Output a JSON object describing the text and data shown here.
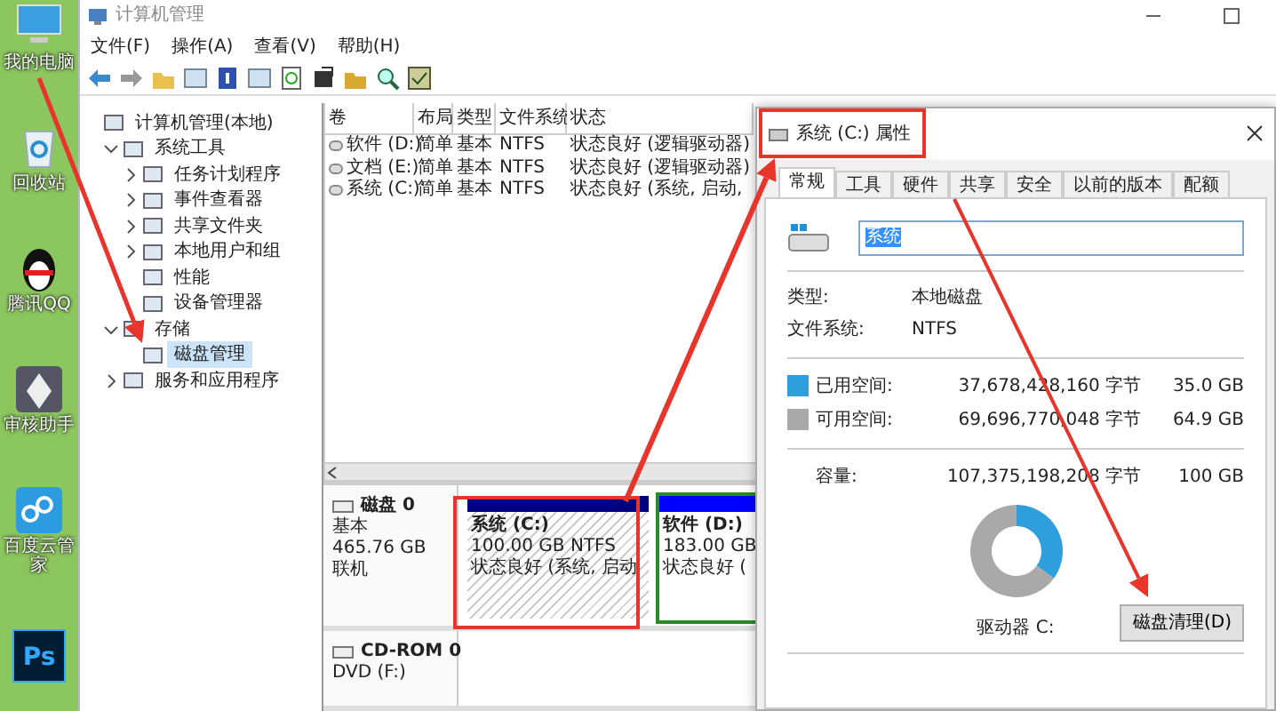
{
  "desktop": {
    "icons": [
      {
        "kind": "computer",
        "label": "我的电脑"
      },
      {
        "kind": "recycle",
        "label": "回收站"
      },
      {
        "kind": "penguin",
        "label": "腾讯QQ"
      },
      {
        "kind": "pen",
        "label": "审核助手"
      },
      {
        "kind": "cloud",
        "label": "百度云管家"
      },
      {
        "kind": "ps",
        "logo_text": "Ps"
      }
    ]
  },
  "window": {
    "title": "计算机管理",
    "menu": [
      "文件(F)",
      "操作(A)",
      "查看(V)",
      "帮助(H)"
    ]
  },
  "tree": [
    {
      "label": "计算机管理(本地)",
      "selected": false,
      "children": [
        {
          "label": "系统工具",
          "expanded": true,
          "selected": false,
          "children": [
            {
              "label": "任务计划程序",
              "expanded": false,
              "selected": false
            },
            {
              "label": "事件查看器",
              "expanded": false,
              "selected": false
            },
            {
              "label": "共享文件夹",
              "expanded": false,
              "selected": false
            },
            {
              "label": "本地用户和组",
              "expanded": false,
              "selected": false
            },
            {
              "label": "性能",
              "selected": false
            },
            {
              "label": "设备管理器",
              "selected": false
            }
          ]
        },
        {
          "label": "存储",
          "expanded": true,
          "selected": false,
          "children": [
            {
              "label": "磁盘管理",
              "selected": true
            }
          ]
        },
        {
          "label": "服务和应用程序",
          "expanded": false,
          "selected": false
        }
      ]
    }
  ],
  "volume_table": {
    "columns": [
      "卷",
      "布局",
      "类型",
      "文件系统",
      "状态"
    ],
    "rows": [
      [
        "软件 (D:)",
        "简单",
        "基本",
        "NTFS",
        "状态良好 (逻辑驱动器)"
      ],
      [
        "文档 (E:)",
        "简单",
        "基本",
        "NTFS",
        "状态良好 (逻辑驱动器)"
      ],
      [
        "系统 (C:)",
        "简单",
        "基本",
        "NTFS",
        "状态良好 (系统, 启动,"
      ]
    ]
  },
  "disk_map": [
    {
      "name": "磁盘 0",
      "details": [
        "基本",
        "465.76 GB",
        "联机"
      ],
      "partitions": [
        {
          "kind": "primary",
          "selected": true,
          "name": "系统 (C:)",
          "size": "100.00 GB NTFS",
          "status": "状态良好 (系统, 启动"
        },
        {
          "kind": "logical",
          "selected": false,
          "name": "软件 (D:)",
          "size": "183.00 GB",
          "status": "状态良好 ("
        }
      ]
    },
    {
      "name": "CD-ROM 0",
      "details": [
        "DVD (F:)"
      ]
    }
  ],
  "dialog": {
    "title": "系统 (C:) 属性",
    "tabs": [
      {
        "label": "常规",
        "selected": true
      },
      {
        "label": "工具",
        "selected": false
      },
      {
        "label": "硬件",
        "selected": false
      },
      {
        "label": "共享",
        "selected": false
      },
      {
        "label": "安全",
        "selected": false
      },
      {
        "label": "以前的版本",
        "selected": false
      },
      {
        "label": "配额",
        "selected": false
      }
    ],
    "name_value": "系统",
    "properties": [
      {
        "label": "类型:",
        "value": "本地磁盘"
      },
      {
        "label": "文件系统:",
        "value": "NTFS"
      }
    ],
    "space": [
      {
        "label": "已用空间:",
        "bytes": "37,678,428,160 字节",
        "size": "35.0 GB",
        "color": "#2e9fdc"
      },
      {
        "label": "可用空间:",
        "bytes": "69,696,770,048 字节",
        "size": "64.9 GB",
        "color": "#a9a9a9"
      }
    ],
    "capacity": {
      "label": "容量:",
      "bytes": "107,375,198,208 字节",
      "size": "100 GB"
    },
    "chart_data": {
      "type": "donut",
      "values": [
        35.0,
        64.9
      ]
    },
    "drive_label": "驱动器 C:",
    "cleanup_button": "磁盘清理(D)"
  }
}
